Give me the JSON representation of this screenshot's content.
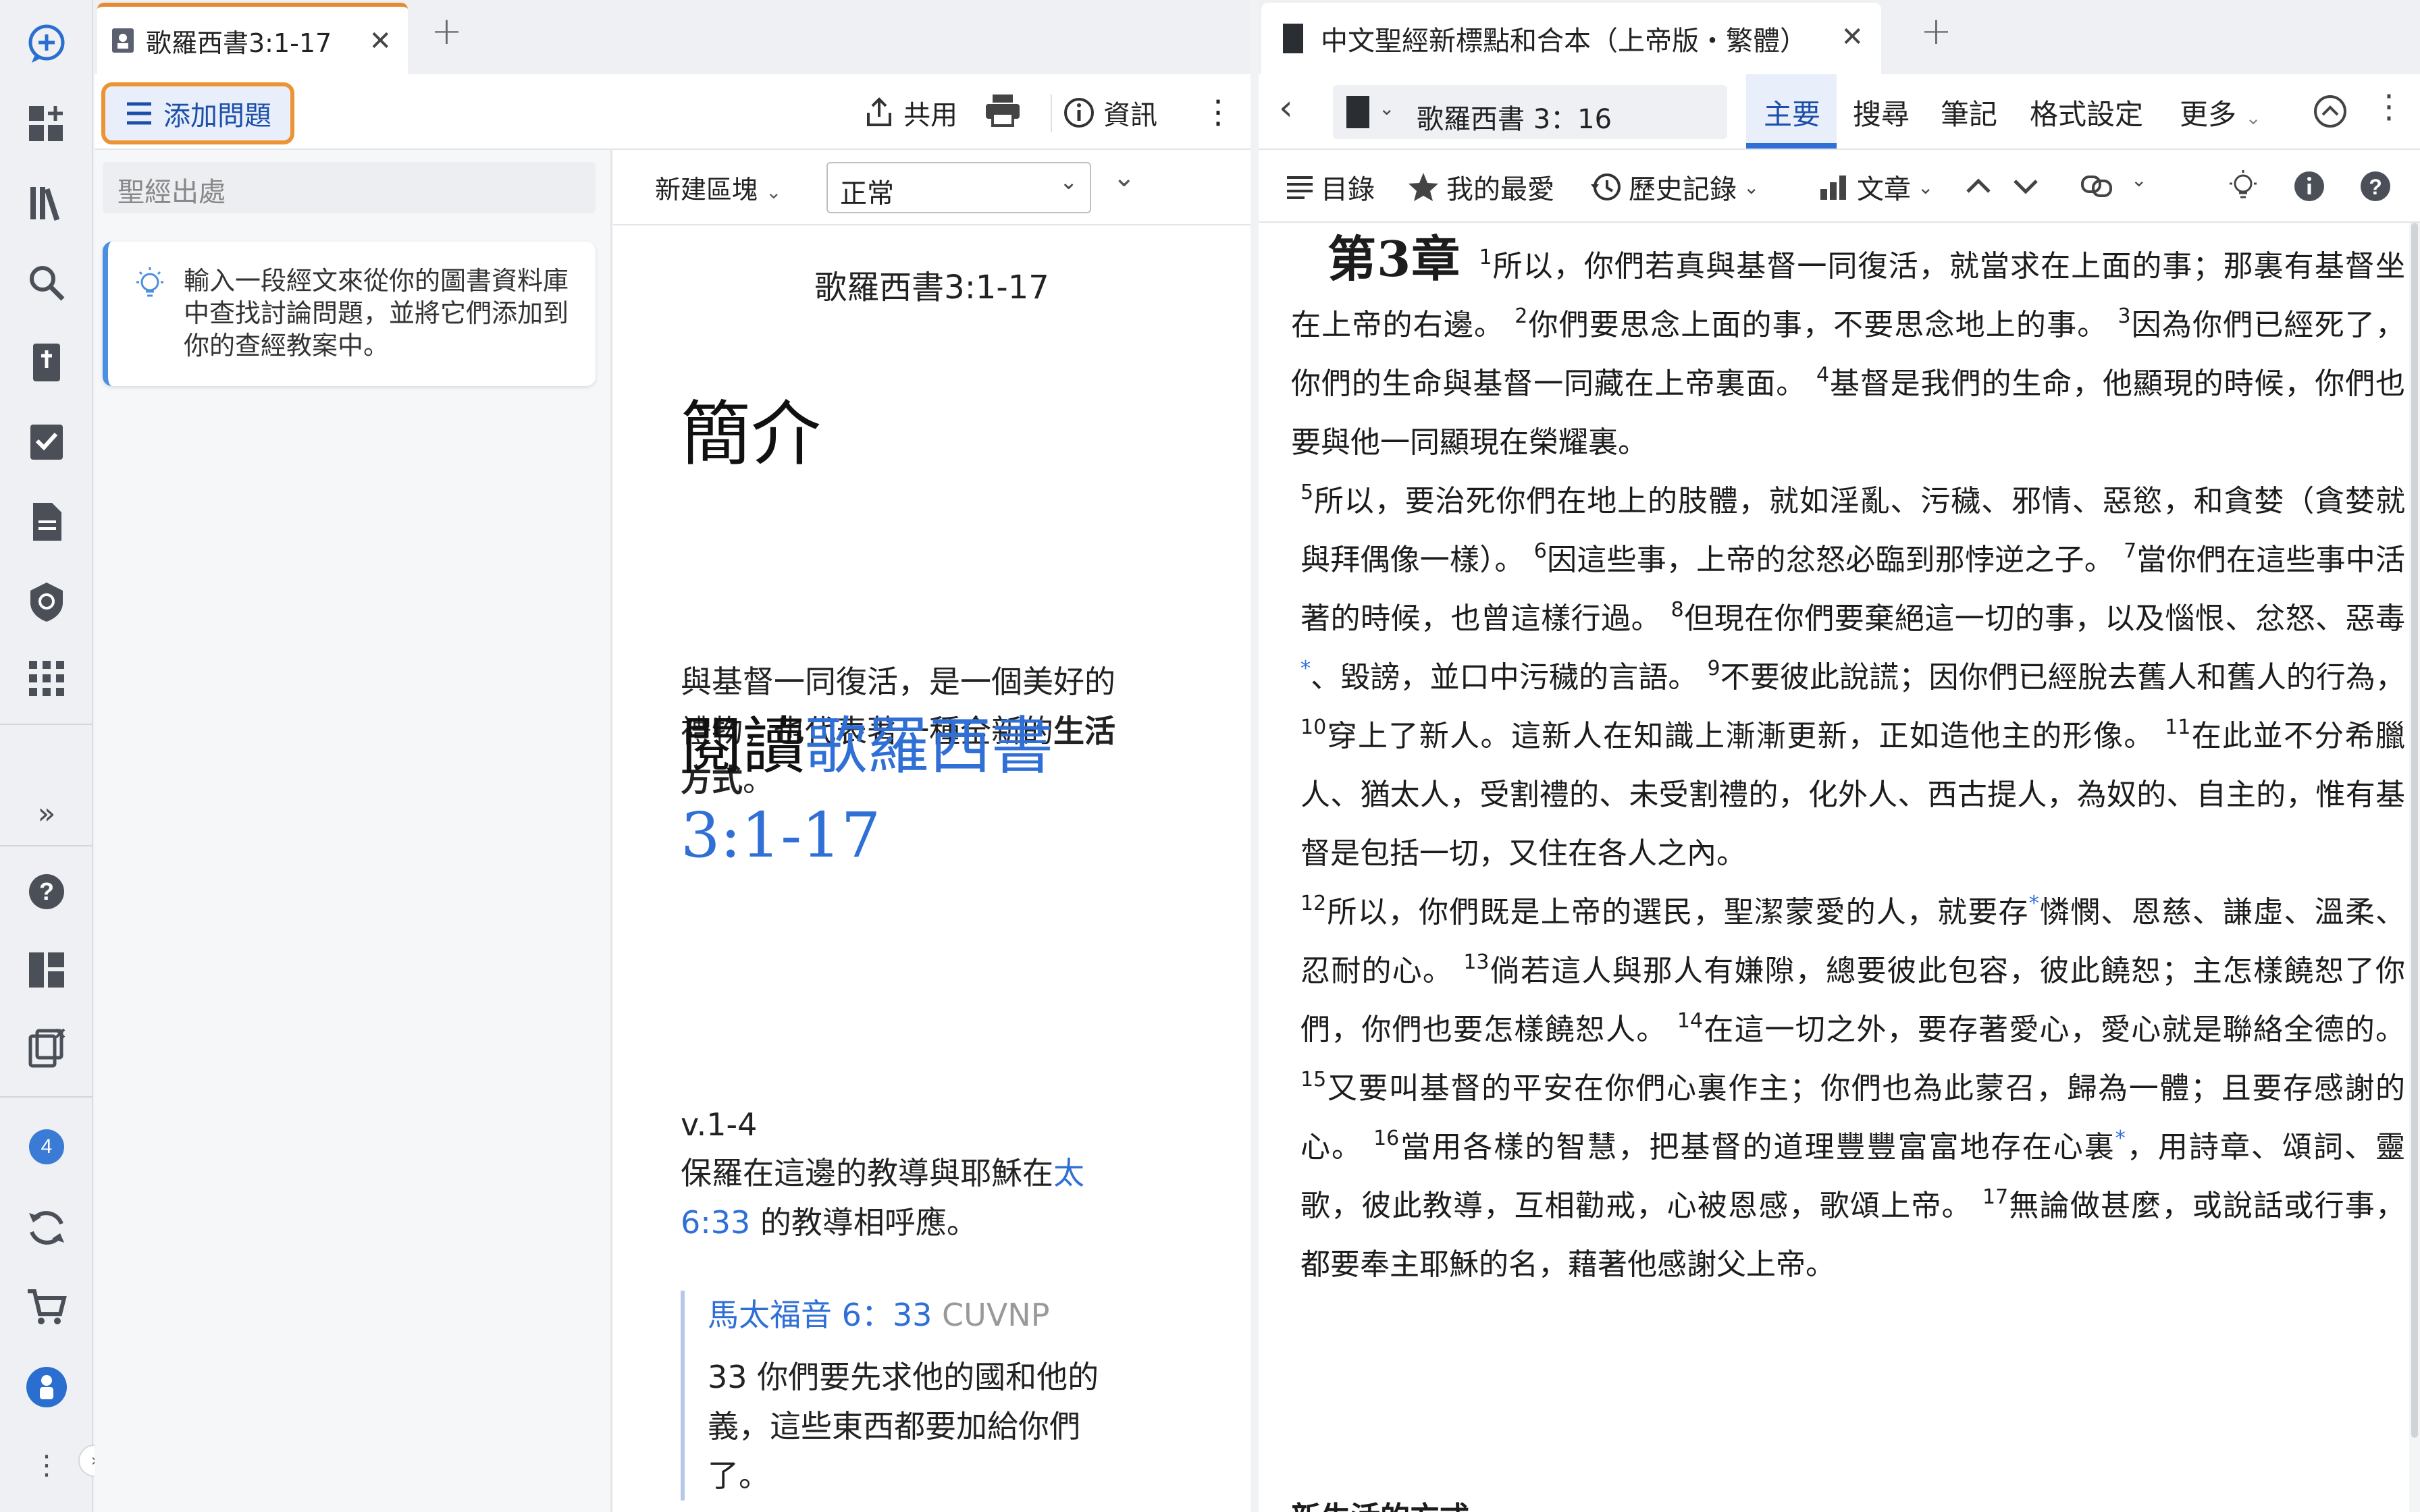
{
  "rail": {
    "items": [
      "add-study-icon",
      "dashboard-add-icon",
      "library-icon",
      "search-icon",
      "bible-icon",
      "checklist-icon",
      "document-icon",
      "shield-icon",
      "apps-grid-icon"
    ],
    "expand_glyph": "»",
    "help_glyph": "?",
    "notification_count": "4"
  },
  "left_tab": {
    "label": "歌羅西書3:1-17",
    "close": "✕",
    "plus": "+"
  },
  "left_toolbar": {
    "add_question": "添加問題",
    "share": "共用",
    "info": "資訊"
  },
  "search_column": {
    "placeholder": "聖經出處",
    "tip": "輸入一段經文來從你的圖書資料庫中查找討論問題，並將它們添加到你的查經教案中。"
  },
  "doc_toolbar": {
    "new_block": "新建區塊",
    "style_value": "正常"
  },
  "doc": {
    "title": "歌羅西書3:1-17",
    "intro_heading": "簡介",
    "intro_text_a": "與基督一同復活，是一個美好的禮物，也代表著一種全新的",
    "intro_text_b": "生活方式",
    "intro_text_c": "。",
    "read_prefix": "閱讀",
    "read_link": "歌羅西書3:1-17",
    "verse_range": "v.1-4",
    "verse_text_a": "保羅在這邊的教導與耶穌在",
    "verse_link": "太6:33",
    "verse_text_b": " 的教導相呼應。",
    "quote_ref": "馬太福音 6：33",
    "quote_version": "CUVNP",
    "quote_text": "33 你們要先求他的國和他的義，這些東西都要加給你們了。"
  },
  "right_tab": {
    "label": "中文聖經新標點和合本（上帝版・繁體）",
    "close": "✕",
    "plus": "+"
  },
  "right_toolbar": {
    "reference": "歌羅西書 3：16",
    "tabs": [
      "主要",
      "搜尋",
      "筆記",
      "格式設定",
      "更多"
    ],
    "active_tab": "主要"
  },
  "right_toolbar2": {
    "toc": "目錄",
    "favorites": "我的最愛",
    "history": "歷史記錄",
    "text_menu": "文章"
  },
  "bible": {
    "chapter": "第3章",
    "p1": [
      {
        "n": "1",
        "t": "所以，你們若真與基督一同復活，就當求在上面的事；那裏有基督坐在上帝的右邊。"
      },
      {
        "n": "2",
        "t": "你們要思念上面的事，不要思念地上的事。"
      },
      {
        "n": "3",
        "t": "因為你們已經死了，你們的生命與基督一同藏在上帝裏面。"
      },
      {
        "n": "4",
        "t": "基督是我們的生命，他顯現的時候，你們也要與他一同顯現在榮耀裏。"
      }
    ],
    "p2": [
      {
        "n": "5",
        "t": "所以，要治死你們在地上的肢體，就如淫亂、污穢、邪情、惡慾，和貪婪（貪婪就與拜偶像一樣）。"
      },
      {
        "n": "6",
        "t": "因這些事，上帝的忿怒必臨到那悖逆之子。"
      },
      {
        "n": "7",
        "t": "當你們在這些事中活著的時候，也曾這樣行過。"
      },
      {
        "n": "8",
        "t": "但現在你們要棄絕這一切的事，以及惱恨、忿怒、惡毒*、毀謗，並口中污穢的言語。"
      },
      {
        "n": "9",
        "t": "不要彼此說謊；因你們已經脫去舊人和舊人的行為，"
      },
      {
        "n": "10",
        "t": "穿上了新人。這新人在知識上漸漸更新，正如造他主的形像。"
      },
      {
        "n": "11",
        "t": "在此並不分希臘人、猶太人，受割禮的、未受割禮的，化外人、西古提人，為奴的、自主的，惟有基督是包括一切，又住在各人之內。"
      }
    ],
    "p3": [
      {
        "n": "12",
        "t": "所以，你們既是上帝的選民，聖潔蒙愛的人，就要存*憐憫、恩慈、謙虛、溫柔、忍耐的心。"
      },
      {
        "n": "13",
        "t": "倘若這人與那人有嫌隙，總要彼此包容，彼此饒恕；主怎樣饒恕了你們，你們也要怎樣饒恕人。"
      },
      {
        "n": "14",
        "t": "在這一切之外，要存著愛心，愛心就是聯絡全德的。"
      },
      {
        "n": "15",
        "t": "又要叫基督的平安在你們心裏作主；你們也為此蒙召，歸為一體；且要存感謝的心。"
      },
      {
        "n": "16",
        "t": "當用各樣的智慧，把基督的道理豐豐富富地存在心裏*，用詩章、頌詞、靈歌，彼此教導，互相勸戒，心被恩感，歌頌上帝。"
      },
      {
        "n": "17",
        "t": "無論做甚麼，或說話或行事，都要奉主耶穌的名，藉著他感謝父上帝。"
      }
    ],
    "next_heading": "新生活的方式"
  },
  "colors": {
    "accent": "#2f6fd6",
    "highlight_border": "#ec9434",
    "tab_top": "#e58a32"
  }
}
